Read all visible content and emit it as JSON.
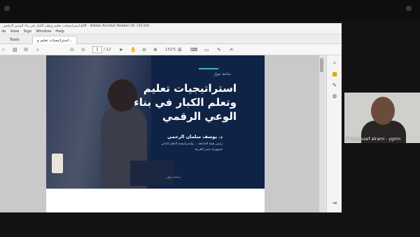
{
  "window": {
    "title": "استراتيجيات تعليم وتعلم الكبار في بناء الوعي الرقمي.pdf - Adobe Acrobat Reader DC (32-bit)",
    "menu": [
      "ile",
      "View",
      "Sign",
      "Window",
      "Help"
    ]
  },
  "tabs": {
    "tools": "Tools",
    "document": "استراتيجيات تعليم و..."
  },
  "toolbar": {
    "page_current": "1",
    "page_total": "/ 12",
    "zoom": "152%"
  },
  "slide": {
    "kicker": "ساحة حوار",
    "title_line1": "استراتيجيات تعليم",
    "title_line2": "وتعلم الكبار في بناء",
    "title_line3": "الوعي الرقمي",
    "presenter": "د. يوسف سلمان الرحمي",
    "role_line1": "رئيس هيئة الجامعة ... واستراتيجية التعلم الذكي",
    "role_line2": "جمهورية مصر العربية",
    "footer": "ساحة حوار"
  },
  "video": {
    "participant_label": "ill dr.yousef alrami - ygmn"
  },
  "colors": {
    "slide_bg": "#0f2346",
    "accent": "#3fb5c6"
  }
}
